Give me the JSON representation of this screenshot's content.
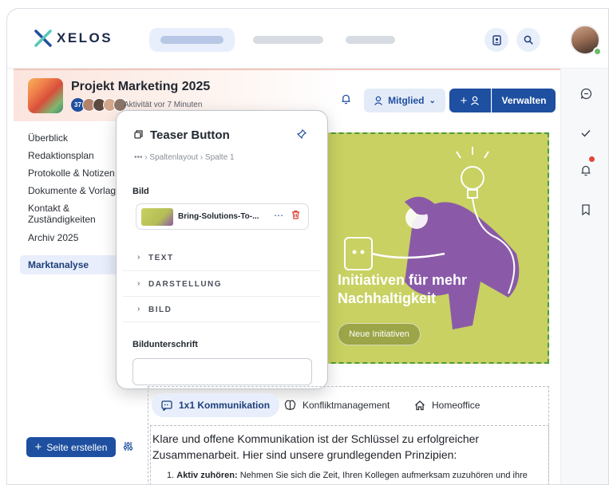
{
  "app": {
    "logo_text": "XELOS"
  },
  "project": {
    "title": "Projekt Marketing 2025",
    "member_count": "37",
    "activity": "Aktivität vor 7 Minuten",
    "member_button": "Mitglied",
    "manage_button": "Verwalten"
  },
  "nav": {
    "items": [
      "Überblick",
      "Redaktionsplan",
      "Protokolle & Notizen",
      "Dokumente & Vorlag",
      "Kontakt & Zuständigkeiten",
      "Archiv 2025"
    ],
    "active": "Marktanalyse",
    "create_button": "Seite erstellen"
  },
  "hero": {
    "title": "Initiativen für mehr Nachhaltigkeit",
    "button": "Neue Initiativen"
  },
  "popup": {
    "title": "Teaser Button",
    "breadcrumb": [
      "Spaltenlayout",
      "Spalte 1"
    ],
    "image_label": "Bild",
    "image_name": "Bring-Solutions-To-...",
    "accordions": [
      "TEXT",
      "DARSTELLUNG",
      "BILD"
    ],
    "caption_label": "Bildunterschrift",
    "caption_value": ""
  },
  "tabs": {
    "items": [
      "1x1 Kommunikation",
      "Konfliktmanagement",
      "Homeoffice"
    ],
    "active_index": 0
  },
  "content": {
    "lead": "Klare und offene Kommunikation ist der Schlüssel zu erfolgreicher Zusammenarbeit. Hier sind unsere grundlegenden Prinzipien:",
    "item_number": "1.",
    "item_bold": "Aktiv zuhören:",
    "item_text": " Nehmen Sie sich die Zeit, Ihren Kollegen aufmerksam zuzuhören und ihre Perspektiven zu verstehen."
  },
  "colors": {
    "primary": "#1e4fa0",
    "hero_bg": "#c8d162",
    "hero_figure": "#8a5aa8",
    "danger": "#d93a2f",
    "online": "#6dbb6b"
  },
  "icons": [
    "xelos-logo-icon",
    "contacts-icon",
    "search-icon",
    "chat-icon",
    "check-icon",
    "bell-icon",
    "bookmark-icon",
    "copy-icon",
    "pin-icon",
    "more-icon",
    "trash-icon",
    "chevron-right-icon",
    "plus-icon",
    "user-icon",
    "filter-icon",
    "brain-icon",
    "home-icon"
  ]
}
